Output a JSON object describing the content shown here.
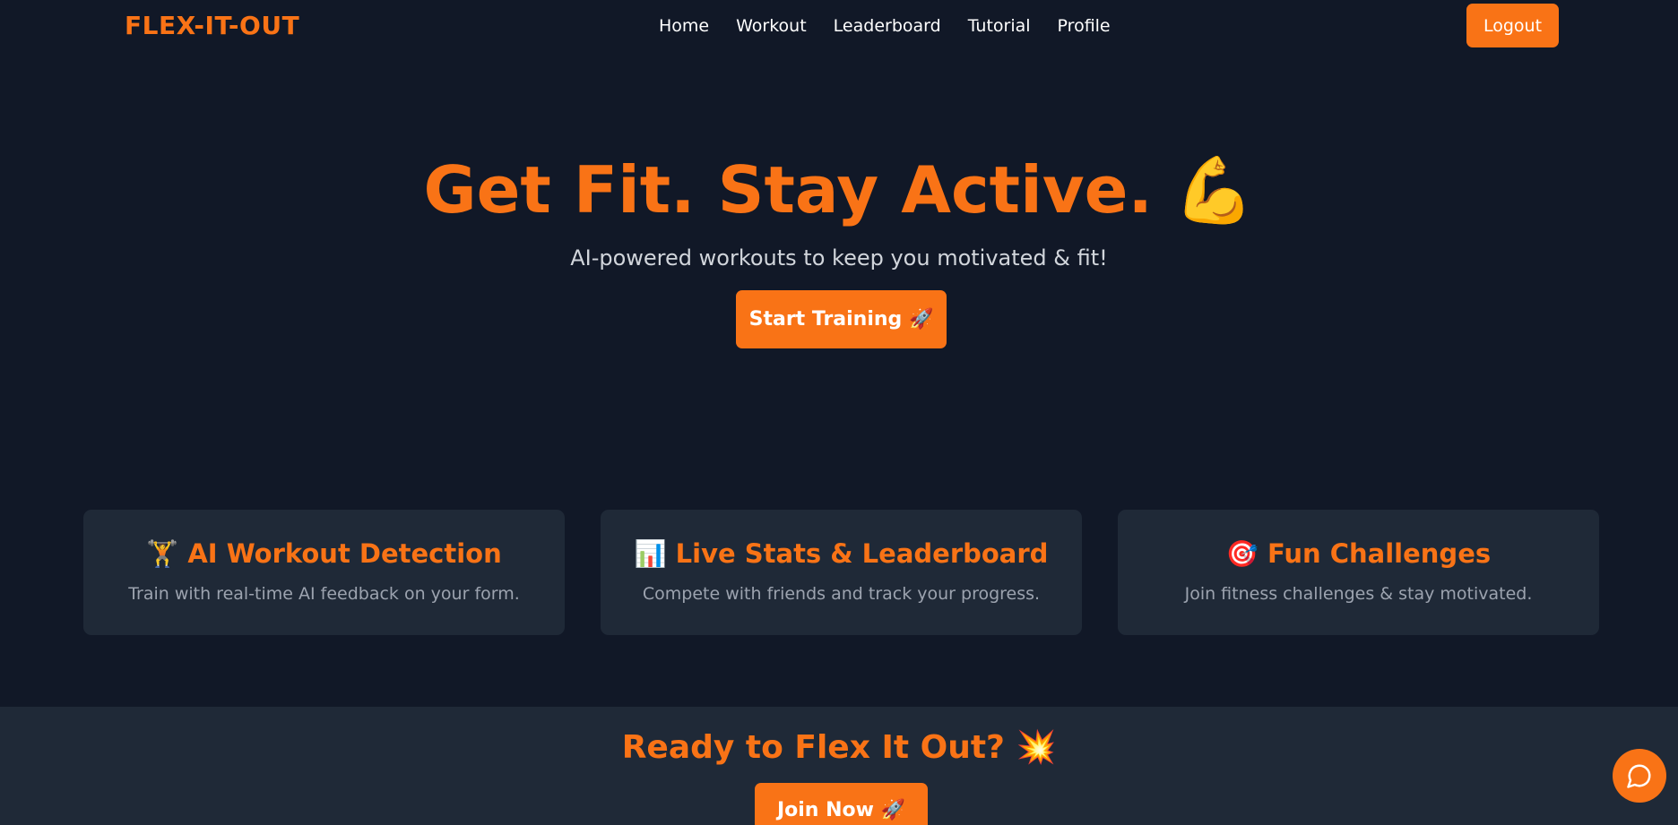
{
  "nav": {
    "brand": "FLEX-IT-OUT",
    "links": [
      "Home",
      "Workout",
      "Leaderboard",
      "Tutorial",
      "Profile"
    ],
    "logout_label": "Logout"
  },
  "hero": {
    "title": "Get Fit. Stay Active.",
    "title_emoji": "💪",
    "subtitle": "AI-powered workouts to keep you motivated & fit!",
    "cta_label": "Start Training 🚀"
  },
  "features": [
    {
      "icon": "🏋️",
      "title": "AI Workout Detection",
      "description": "Train with real-time AI feedback on your form."
    },
    {
      "icon": "📊",
      "title": "Live Stats & Leaderboard",
      "description": "Compete with friends and track your progress."
    },
    {
      "icon": "🎯",
      "title": "Fun Challenges",
      "description": "Join fitness challenges & stay motivated."
    }
  ],
  "cta": {
    "title": "Ready to Flex It Out? 💥",
    "button_label": "Join Now 🚀"
  },
  "chat": {
    "icon": "chat-bubble-icon"
  },
  "colors": {
    "background": "#111827",
    "card": "#1f2937",
    "accent": "#f97316"
  }
}
